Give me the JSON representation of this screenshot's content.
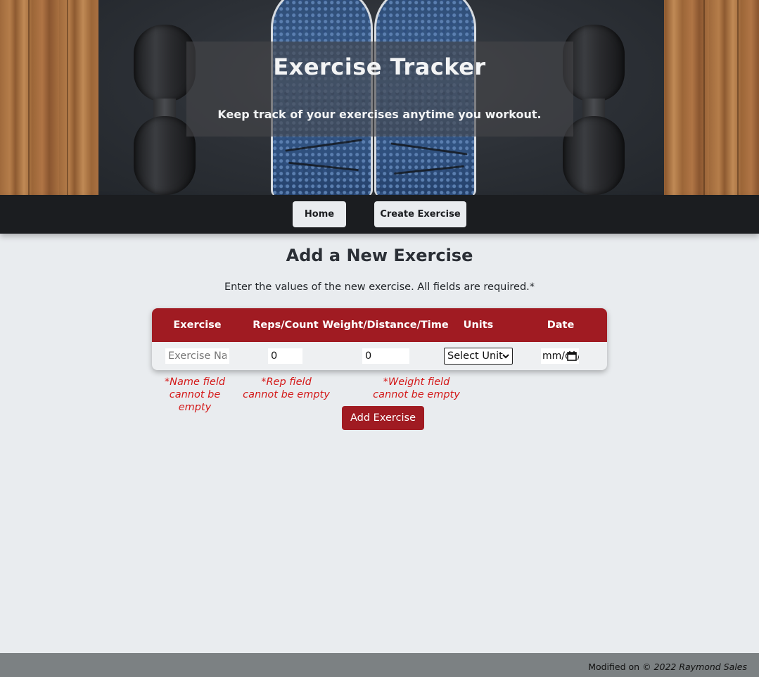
{
  "hero": {
    "title": "Exercise Tracker",
    "tagline": "Keep track of your exercises anytime you workout."
  },
  "nav": {
    "items": [
      {
        "label": "Home"
      },
      {
        "label": "Create Exercise"
      }
    ]
  },
  "main": {
    "title": "Add a New Exercise",
    "instructions": "Enter the values of the new exercise. All fields are required.*",
    "table": {
      "headers": [
        "Exercise",
        "Reps/Count",
        "Weight/Distance/Time",
        "Units",
        "Date"
      ],
      "name_placeholder": "Exercise Name",
      "reps_value": "0",
      "weight_value": "0",
      "units_selected": "Select Unit",
      "date_value": "mm/dd/yyyy"
    },
    "errors": {
      "name": "*Name field cannot be empty",
      "reps": "*Rep field cannot be empty",
      "weight": "*Weight field cannot be empty"
    },
    "submit_label": "Add Exercise"
  },
  "footer": {
    "prefix": "Modified on",
    "copyright": "© 2022 Raymond Sales"
  },
  "colors": {
    "accent": "#a01b22",
    "nav_bg": "#1b1d20",
    "page_bg": "#e9ecef",
    "error": "#d41a1a",
    "footer_bg": "#7c8183"
  }
}
